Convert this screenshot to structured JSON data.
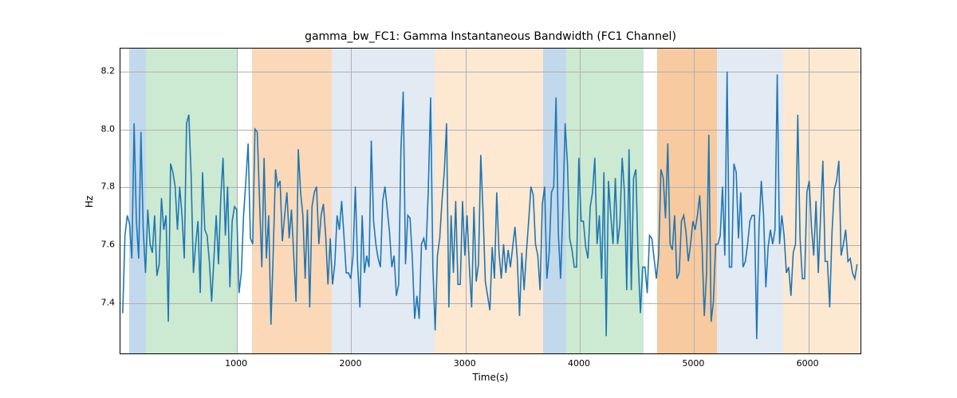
{
  "chart_data": {
    "type": "line",
    "title": "gamma_bw_FC1: Gamma Instantaneous Bandwidth (FC1 Channel)",
    "xlabel": "Time(s)",
    "ylabel": "Hz",
    "xlim": [
      -20,
      6470
    ],
    "ylim": [
      7.22,
      8.28
    ],
    "xticks": [
      1000,
      2000,
      3000,
      4000,
      5000,
      6000
    ],
    "yticks": [
      7.4,
      7.6,
      7.8,
      8.0,
      8.2
    ],
    "layout": {
      "ax_left": 150,
      "ax_top": 60,
      "ax_width": 930,
      "ax_height": 385
    },
    "bands": [
      {
        "x0": 60,
        "x1": 200,
        "color": "#c2d8ec"
      },
      {
        "x0": 200,
        "x1": 1000,
        "color": "#ccead1"
      },
      {
        "x0": 1130,
        "x1": 1830,
        "color": "#fbd9b8"
      },
      {
        "x0": 1830,
        "x1": 2730,
        "color": "#e2eaf4"
      },
      {
        "x0": 2730,
        "x1": 3680,
        "color": "#fde8d2"
      },
      {
        "x0": 3680,
        "x1": 3880,
        "color": "#c2d8ec"
      },
      {
        "x0": 3880,
        "x1": 4560,
        "color": "#ccead1"
      },
      {
        "x0": 4680,
        "x1": 5200,
        "color": "#f7caa0"
      },
      {
        "x0": 5200,
        "x1": 5780,
        "color": "#e2eaf4"
      },
      {
        "x0": 5780,
        "x1": 6450,
        "color": "#fde8d2"
      }
    ],
    "line_color": "#1f77b4",
    "x": [
      0,
      20,
      40,
      60,
      80,
      100,
      120,
      140,
      160,
      180,
      200,
      220,
      240,
      260,
      280,
      300,
      320,
      340,
      360,
      380,
      400,
      420,
      440,
      460,
      480,
      500,
      520,
      540,
      560,
      580,
      600,
      620,
      640,
      660,
      680,
      700,
      720,
      740,
      760,
      780,
      800,
      820,
      840,
      860,
      880,
      900,
      920,
      940,
      960,
      980,
      1000,
      1020,
      1040,
      1060,
      1080,
      1100,
      1120,
      1140,
      1160,
      1180,
      1200,
      1220,
      1240,
      1260,
      1280,
      1300,
      1320,
      1340,
      1360,
      1380,
      1400,
      1420,
      1440,
      1460,
      1480,
      1500,
      1520,
      1540,
      1560,
      1580,
      1600,
      1620,
      1640,
      1660,
      1680,
      1700,
      1720,
      1740,
      1760,
      1780,
      1800,
      1820,
      1840,
      1860,
      1880,
      1900,
      1920,
      1940,
      1960,
      1980,
      2000,
      2020,
      2040,
      2060,
      2080,
      2100,
      2120,
      2140,
      2160,
      2180,
      2200,
      2220,
      2240,
      2260,
      2280,
      2300,
      2320,
      2340,
      2360,
      2380,
      2400,
      2420,
      2440,
      2460,
      2480,
      2500,
      2520,
      2540,
      2560,
      2580,
      2600,
      2620,
      2640,
      2660,
      2680,
      2700,
      2720,
      2740,
      2760,
      2780,
      2800,
      2820,
      2840,
      2860,
      2880,
      2900,
      2920,
      2940,
      2960,
      2980,
      3000,
      3020,
      3040,
      3060,
      3080,
      3100,
      3120,
      3140,
      3160,
      3180,
      3200,
      3220,
      3240,
      3260,
      3280,
      3300,
      3320,
      3340,
      3360,
      3380,
      3400,
      3420,
      3440,
      3460,
      3480,
      3500,
      3520,
      3540,
      3560,
      3580,
      3600,
      3620,
      3640,
      3660,
      3680,
      3700,
      3720,
      3740,
      3760,
      3780,
      3800,
      3820,
      3840,
      3860,
      3880,
      3900,
      3920,
      3940,
      3960,
      3980,
      4000,
      4020,
      4040,
      4060,
      4080,
      4100,
      4120,
      4140,
      4160,
      4180,
      4200,
      4220,
      4240,
      4260,
      4280,
      4300,
      4320,
      4340,
      4360,
      4380,
      4400,
      4420,
      4440,
      4460,
      4480,
      4500,
      4520,
      4540,
      4560,
      4580,
      4600,
      4620,
      4640,
      4660,
      4680,
      4700,
      4720,
      4740,
      4760,
      4780,
      4800,
      4820,
      4840,
      4860,
      4880,
      4900,
      4920,
      4940,
      4960,
      4980,
      5000,
      5020,
      5040,
      5060,
      5080,
      5100,
      5120,
      5140,
      5160,
      5180,
      5200,
      5220,
      5240,
      5260,
      5280,
      5300,
      5320,
      5340,
      5360,
      5380,
      5400,
      5420,
      5440,
      5460,
      5480,
      5500,
      5520,
      5540,
      5560,
      5580,
      5600,
      5620,
      5640,
      5660,
      5680,
      5700,
      5720,
      5740,
      5760,
      5780,
      5800,
      5820,
      5840,
      5860,
      5880,
      5900,
      5920,
      5940,
      5960,
      5980,
      6000,
      6020,
      6040,
      6060,
      6080,
      6100,
      6120,
      6140,
      6160,
      6180,
      6200,
      6220,
      6240,
      6260,
      6280,
      6300,
      6320,
      6340,
      6360,
      6380,
      6400,
      6420,
      6440
    ],
    "values": [
      7.36,
      7.63,
      7.7,
      7.67,
      7.55,
      8.02,
      7.68,
      7.55,
      7.99,
      7.65,
      7.5,
      7.72,
      7.6,
      7.57,
      7.7,
      7.49,
      7.53,
      7.76,
      7.65,
      7.7,
      7.33,
      7.88,
      7.85,
      7.8,
      7.65,
      7.8,
      7.7,
      7.55,
      8.02,
      8.05,
      7.84,
      7.5,
      7.6,
      7.68,
      7.43,
      7.85,
      7.65,
      7.63,
      7.54,
      7.4,
      7.55,
      7.7,
      7.53,
      7.76,
      7.9,
      7.63,
      7.8,
      7.45,
      7.68,
      7.73,
      7.72,
      7.43,
      7.5,
      7.7,
      7.82,
      7.95,
      7.62,
      7.6,
      8.0,
      7.99,
      7.75,
      7.52,
      7.9,
      7.55,
      7.7,
      7.32,
      7.57,
      7.86,
      7.8,
      7.82,
      7.61,
      7.7,
      7.78,
      7.62,
      7.72,
      7.56,
      7.4,
      7.93,
      7.78,
      7.7,
      7.48,
      7.72,
      7.38,
      7.73,
      7.78,
      7.8,
      7.6,
      7.7,
      7.74,
      7.63,
      7.46,
      7.62,
      7.46,
      7.53,
      7.7,
      7.65,
      7.75,
      7.63,
      7.5,
      7.5,
      7.48,
      7.56,
      7.8,
      7.53,
      7.38,
      7.7,
      7.5,
      7.56,
      7.52,
      7.96,
      7.68,
      7.6,
      7.55,
      7.52,
      7.75,
      7.8,
      7.72,
      7.64,
      7.52,
      7.56,
      7.42,
      7.46,
      7.93,
      8.13,
      7.53,
      7.7,
      7.69,
      7.55,
      7.34,
      7.42,
      7.34,
      7.6,
      7.62,
      7.58,
      7.79,
      8.11,
      7.52,
      7.3,
      7.56,
      7.62,
      7.75,
      7.85,
      8.02,
      7.38,
      7.7,
      7.5,
      7.75,
      7.46,
      7.46,
      7.75,
      7.56,
      7.7,
      7.52,
      7.38,
      7.73,
      7.47,
      7.53,
      7.91,
      7.71,
      7.47,
      7.42,
      7.37,
      7.59,
      7.48,
      7.78,
      7.57,
      7.48,
      7.6,
      7.5,
      7.58,
      7.52,
      7.59,
      7.66,
      7.55,
      7.35,
      7.57,
      7.44,
      7.57,
      7.68,
      7.8,
      7.77,
      7.6,
      7.56,
      7.44,
      7.74,
      7.8,
      7.48,
      7.57,
      7.78,
      7.8,
      8.11,
      7.64,
      7.48,
      7.72,
      8.02,
      7.88,
      7.62,
      7.58,
      7.52,
      7.52,
      7.9,
      7.68,
      7.68,
      7.59,
      7.55,
      7.73,
      7.78,
      7.9,
      7.6,
      7.7,
      7.48,
      7.85,
      7.28,
      7.82,
      7.7,
      7.6,
      7.83,
      7.6,
      7.67,
      7.9,
      7.78,
      7.44,
      7.93,
      7.44,
      7.83,
      7.86,
      7.55,
      7.36,
      7.52,
      7.52,
      7.43,
      7.63,
      7.62,
      7.55,
      7.48,
      7.56,
      7.86,
      7.83,
      7.69,
      7.95,
      7.6,
      7.58,
      7.7,
      7.48,
      7.5,
      7.68,
      7.7,
      7.64,
      7.54,
      7.6,
      7.68,
      7.65,
      7.7,
      7.77,
      7.6,
      7.35,
      7.5,
      7.98,
      7.33,
      7.4,
      7.6,
      7.6,
      7.63,
      7.8,
      7.56,
      8.2,
      7.52,
      7.52,
      7.88,
      7.85,
      7.62,
      7.78,
      7.52,
      7.54,
      7.6,
      7.68,
      7.7,
      7.7,
      7.27,
      7.66,
      7.82,
      7.7,
      7.45,
      7.59,
      7.65,
      7.6,
      7.65,
      8.19,
      7.6,
      7.7,
      7.63,
      7.5,
      7.52,
      7.42,
      7.57,
      7.6,
      8.05,
      7.62,
      7.48,
      7.48,
      7.78,
      7.82,
      7.66,
      7.56,
      7.75,
      7.5,
      7.7,
      7.89,
      7.54,
      7.54,
      7.38,
      7.64,
      7.79,
      7.82,
      7.89,
      7.56,
      7.6,
      7.65,
      7.54,
      7.55,
      7.5,
      7.48,
      7.53
    ]
  }
}
